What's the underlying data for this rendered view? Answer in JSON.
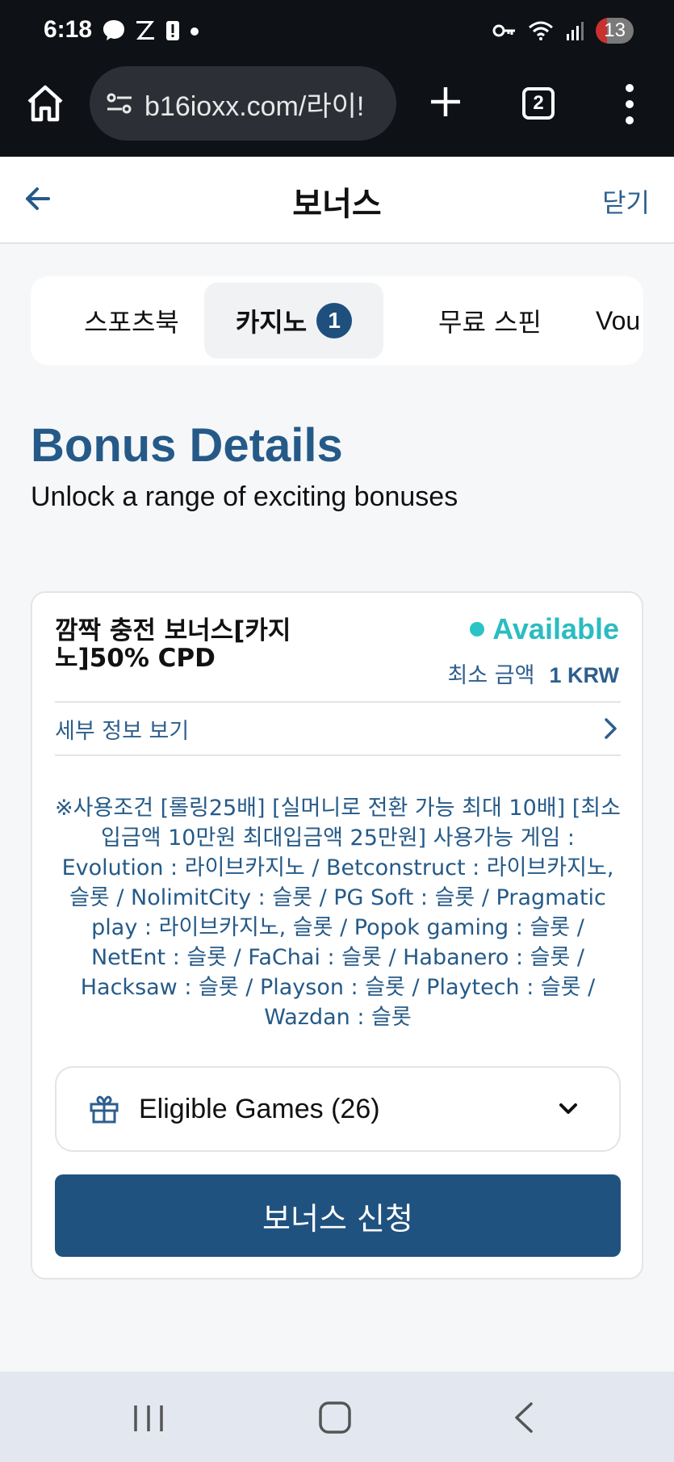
{
  "status_bar": {
    "time": "6:18",
    "battery": "13",
    "icons": [
      "messenger-icon",
      "z-icon",
      "alert-icon",
      "dot-icon",
      "key-icon",
      "wifi-icon",
      "signal-icon"
    ]
  },
  "browser": {
    "url": "b16ioxx.com/라이!",
    "tab_count": "2"
  },
  "header": {
    "title": "보너스",
    "close_label": "닫기"
  },
  "tabs": [
    {
      "label": "스포츠북",
      "active": false
    },
    {
      "label": "카지노",
      "active": true,
      "badge": "1"
    },
    {
      "label": "무료 스핀",
      "active": false
    },
    {
      "label": "Vou",
      "active": false
    }
  ],
  "section": {
    "title": "Bonus Details",
    "subtitle": "Unlock a range of exciting bonuses"
  },
  "bonus": {
    "name": "깜짝 충전 보너스[카지노]50% CPD",
    "status": "Available",
    "status_color": "#2bbcc0",
    "min_label": "최소 금액",
    "min_value": "1 KRW",
    "detail_label": "세부 정보 보기",
    "terms": "※사용조건 [롤링25배] [실머니로 전환 가능 최대 10배] [최소입금액 10만원 최대입금액 25만원] 사용가능 게임 : Evolution : 라이브카지노 / Betconstruct : 라이브카지노, 슬롯 / NolimitCity : 슬롯 / PG Soft : 슬롯 / Pragmatic play : 라이브카지노, 슬롯 / Popok gaming : 슬롯 / NetEnt : 슬롯 / FaChai : 슬롯 / Habanero : 슬롯 / Hacksaw : 슬롯 / Playson : 슬롯 / Playtech : 슬롯 / Wazdan : 슬롯",
    "eligible_label": "Eligible Games (26)",
    "apply_label": "보너스 신청"
  },
  "colors": {
    "accent": "#20527f",
    "title_blue": "#255a88",
    "available": "#2bbcc0"
  }
}
